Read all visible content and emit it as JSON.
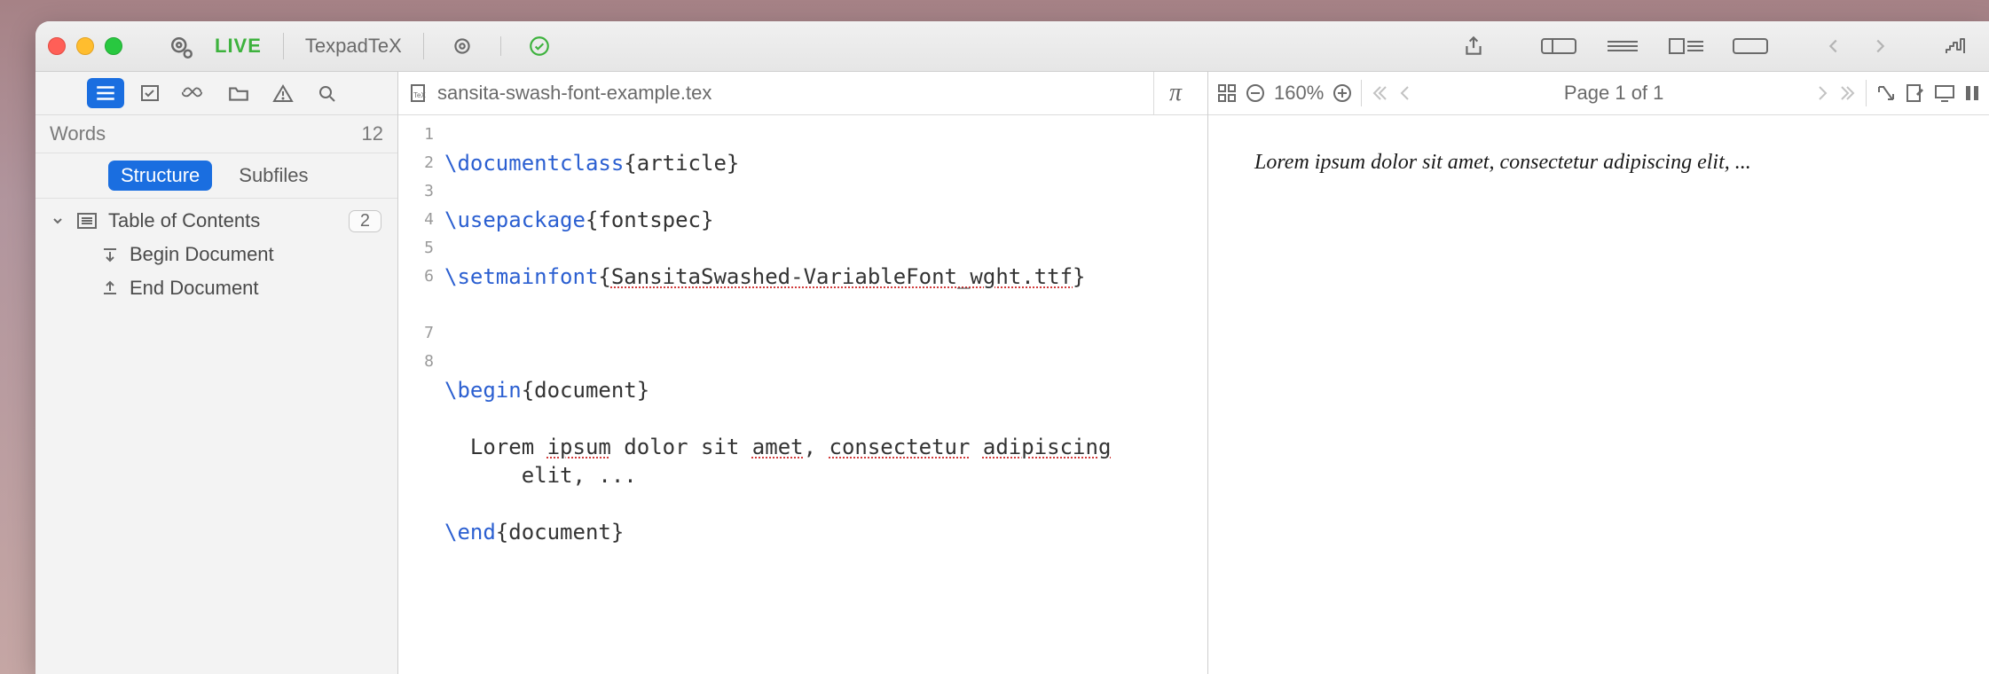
{
  "toolbar": {
    "live_label": "LIVE",
    "engine_label": "TexpadTeX"
  },
  "sidebar": {
    "words_label": "Words",
    "words_count": "12",
    "tabs": {
      "structure": "Structure",
      "subfiles": "Subfiles"
    },
    "toc_label": "Table of Contents",
    "toc_badge": "2",
    "begin_doc": "Begin Document",
    "end_doc": "End Document"
  },
  "editor": {
    "filename": "sansita-swash-font-example.tex",
    "pi": "π",
    "line_numbers": [
      "1",
      "2",
      "3",
      "4",
      "5",
      "6",
      "7",
      "8"
    ],
    "l1_cmd": "\\documentclass",
    "l1_rest": "{article}",
    "l2_cmd": "\\usepackage",
    "l2_rest": "{fontspec}",
    "l3_cmd": "\\setmainfont",
    "l3_brace_open": "{",
    "l3_arg": "SansitaSwashed-VariableFont_wght.ttf",
    "l3_brace_close": "}",
    "l5_cmd": "\\begin",
    "l5_rest": "{document}",
    "l6_a": "  Lorem ",
    "l6_b": "ipsum",
    "l6_c": " dolor sit ",
    "l6_d": "amet",
    "l6_e": ", ",
    "l6_f": "consectetur",
    "l6_g": " ",
    "l6_h": "adipiscing",
    "l6_wrap": "      elit, ...",
    "l7_cmd": "\\end",
    "l7_rest": "{document}"
  },
  "preview": {
    "zoom": "160%",
    "page_label": "Page 1 of 1",
    "rendered_text": "Lorem ipsum dolor sit amet, consectetur adipiscing elit, ..."
  }
}
